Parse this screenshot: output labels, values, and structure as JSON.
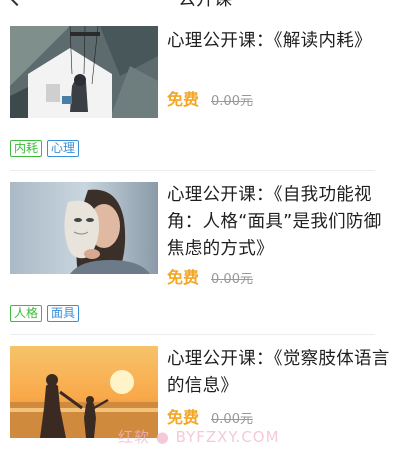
{
  "header": {
    "title": "公开课"
  },
  "courses": [
    {
      "title": "心理公开课：《解读内耗》",
      "price": "免费",
      "original_price": "0.00元",
      "tags": [
        {
          "label": "内耗",
          "color": "#3dbb3d"
        },
        {
          "label": "心理",
          "color": "#3a8fd9"
        }
      ]
    },
    {
      "title": "心理公开课：《自我功能视角：人格“面具”是我们防御焦虑的方式》",
      "price": "免费",
      "original_price": "0.00元",
      "tags": [
        {
          "label": "人格",
          "color": "#3dbb3d"
        },
        {
          "label": "面具",
          "color": "#3a8fd9"
        }
      ]
    },
    {
      "title": "心理公开课：《觉察肢体语言的信息》",
      "price": "免费",
      "original_price": "0.00元",
      "tags": []
    }
  ],
  "watermark": "红软 ● BYFZXY.COM",
  "colors": {
    "price": "#f5a623",
    "tag_green": "#3dbb3d",
    "tag_blue": "#3a8fd9"
  }
}
